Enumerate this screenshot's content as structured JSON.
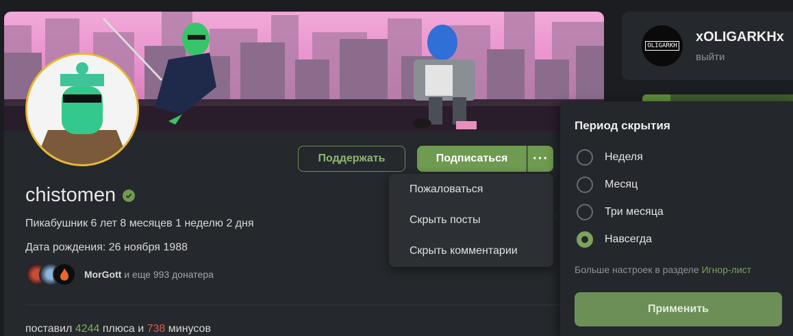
{
  "profile": {
    "username": "chistomen",
    "member_since": "Пикабушник 6 лет 8 месяцев 1 неделю 2 дня",
    "birthday": "Дата рождения: 26 ноября 1988",
    "donors": {
      "top_donor": "MorGott",
      "rest_text": "и еще 993 донатера"
    },
    "karma": {
      "prefix": "поставил",
      "plus_count": "4244",
      "plus_word": "плюса и",
      "minus_count": "738",
      "minus_word": "минусов"
    },
    "buttons": {
      "support": "Поддержать",
      "subscribe": "Подписаться",
      "more": "···"
    }
  },
  "menu": {
    "items": [
      "Пожаловаться",
      "Скрыть посты",
      "Скрыть комментарии"
    ]
  },
  "sidebar": {
    "user_name": "xOLIGARKHx",
    "avatar_text": "OLIGARKH",
    "logout": "выйти"
  },
  "hide_panel": {
    "title": "Период скрытия",
    "options": [
      "Неделя",
      "Месяц",
      "Три месяца",
      "Навсегда"
    ],
    "selected": "Навсегда",
    "hint": "Больше настроек в разделе",
    "hint_link": "Игнор-лист",
    "apply": "Применить"
  },
  "colors": {
    "accent_green": "#6f9a51",
    "plus": "#7fb35a",
    "minus": "#e25b4f",
    "avatar_border": "#e8b731"
  }
}
